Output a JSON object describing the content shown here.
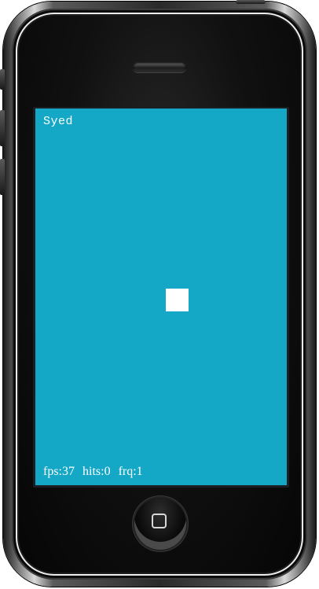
{
  "game": {
    "player_name": "Syed",
    "stats": {
      "fps": "fps:37",
      "hits": "hits:0",
      "frq": "frq:1"
    }
  },
  "colors": {
    "screen_background": "#15a7c6",
    "target": "#ffffff",
    "text": "#ffffff"
  },
  "icons": {
    "home_button": "home-square-icon"
  }
}
